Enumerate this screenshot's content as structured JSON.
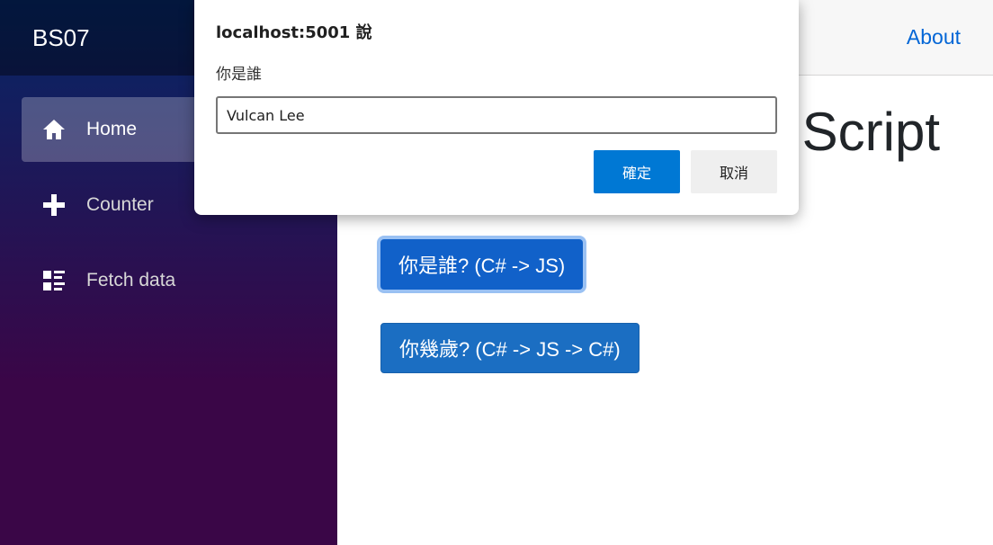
{
  "sidebar": {
    "brand": "BS07",
    "items": [
      {
        "label": "Home",
        "icon": "home-icon",
        "active": true
      },
      {
        "label": "Counter",
        "icon": "plus-icon",
        "active": false
      },
      {
        "label": "Fetch data",
        "icon": "list-rich-icon",
        "active": false
      }
    ]
  },
  "topbar": {
    "about": "About"
  },
  "main": {
    "title": "Script",
    "buttons": {
      "who": "你是誰? (C# -> JS)",
      "age": "你幾歲? (C# -> JS -> C#)"
    }
  },
  "dialog": {
    "origin": "localhost:5001 說",
    "message": "你是誰",
    "input_value": "Vulcan Lee",
    "ok": "確定",
    "cancel": "取消"
  },
  "colors": {
    "accent": "#0078d4",
    "link": "#0366d6",
    "primary_button": "#1b6ec2",
    "sidebar_top": "#052767",
    "sidebar_bottom": "#3a0647"
  }
}
